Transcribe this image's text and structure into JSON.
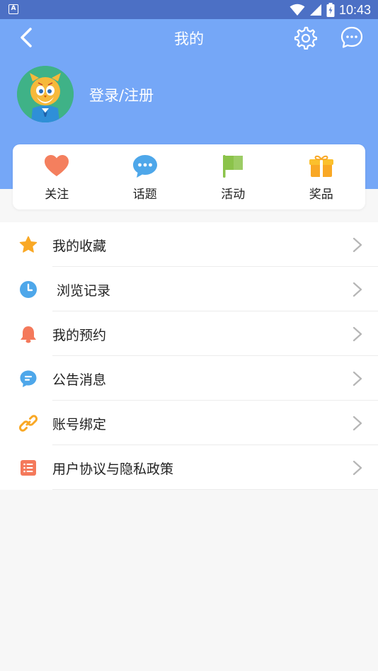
{
  "status_bar": {
    "notification_icon": "A",
    "time": "10:43",
    "icons": [
      "wifi-icon",
      "signal-icon",
      "battery-icon"
    ]
  },
  "header": {
    "title": "我的",
    "login_text": "登录/注册",
    "bg_color": "#75a7f7"
  },
  "quick_actions": [
    {
      "label": "关注",
      "icon": "heart-icon",
      "color": "#f47f5e"
    },
    {
      "label": "话题",
      "icon": "chat-bubble-icon",
      "color": "#4ea7ea"
    },
    {
      "label": "活动",
      "icon": "flag-icon",
      "color": "#8bc34a"
    },
    {
      "label": "奖品",
      "icon": "gift-icon",
      "color": "#f9a825"
    }
  ],
  "menu": [
    {
      "label": "我的收藏",
      "icon": "star-icon",
      "color": "#f9a825"
    },
    {
      "label": "浏览记录",
      "icon": "clock-icon",
      "color": "#4ea7ea"
    },
    {
      "label": "我的预约",
      "icon": "bell-icon",
      "color": "#f4795b"
    },
    {
      "label": "公告消息",
      "icon": "message-icon",
      "color": "#4ea7ea"
    },
    {
      "label": "账号绑定",
      "icon": "link-icon",
      "color": "#f9a825"
    },
    {
      "label": "用户协议与隐私政策",
      "icon": "document-list-icon",
      "color": "#f4795b"
    }
  ]
}
